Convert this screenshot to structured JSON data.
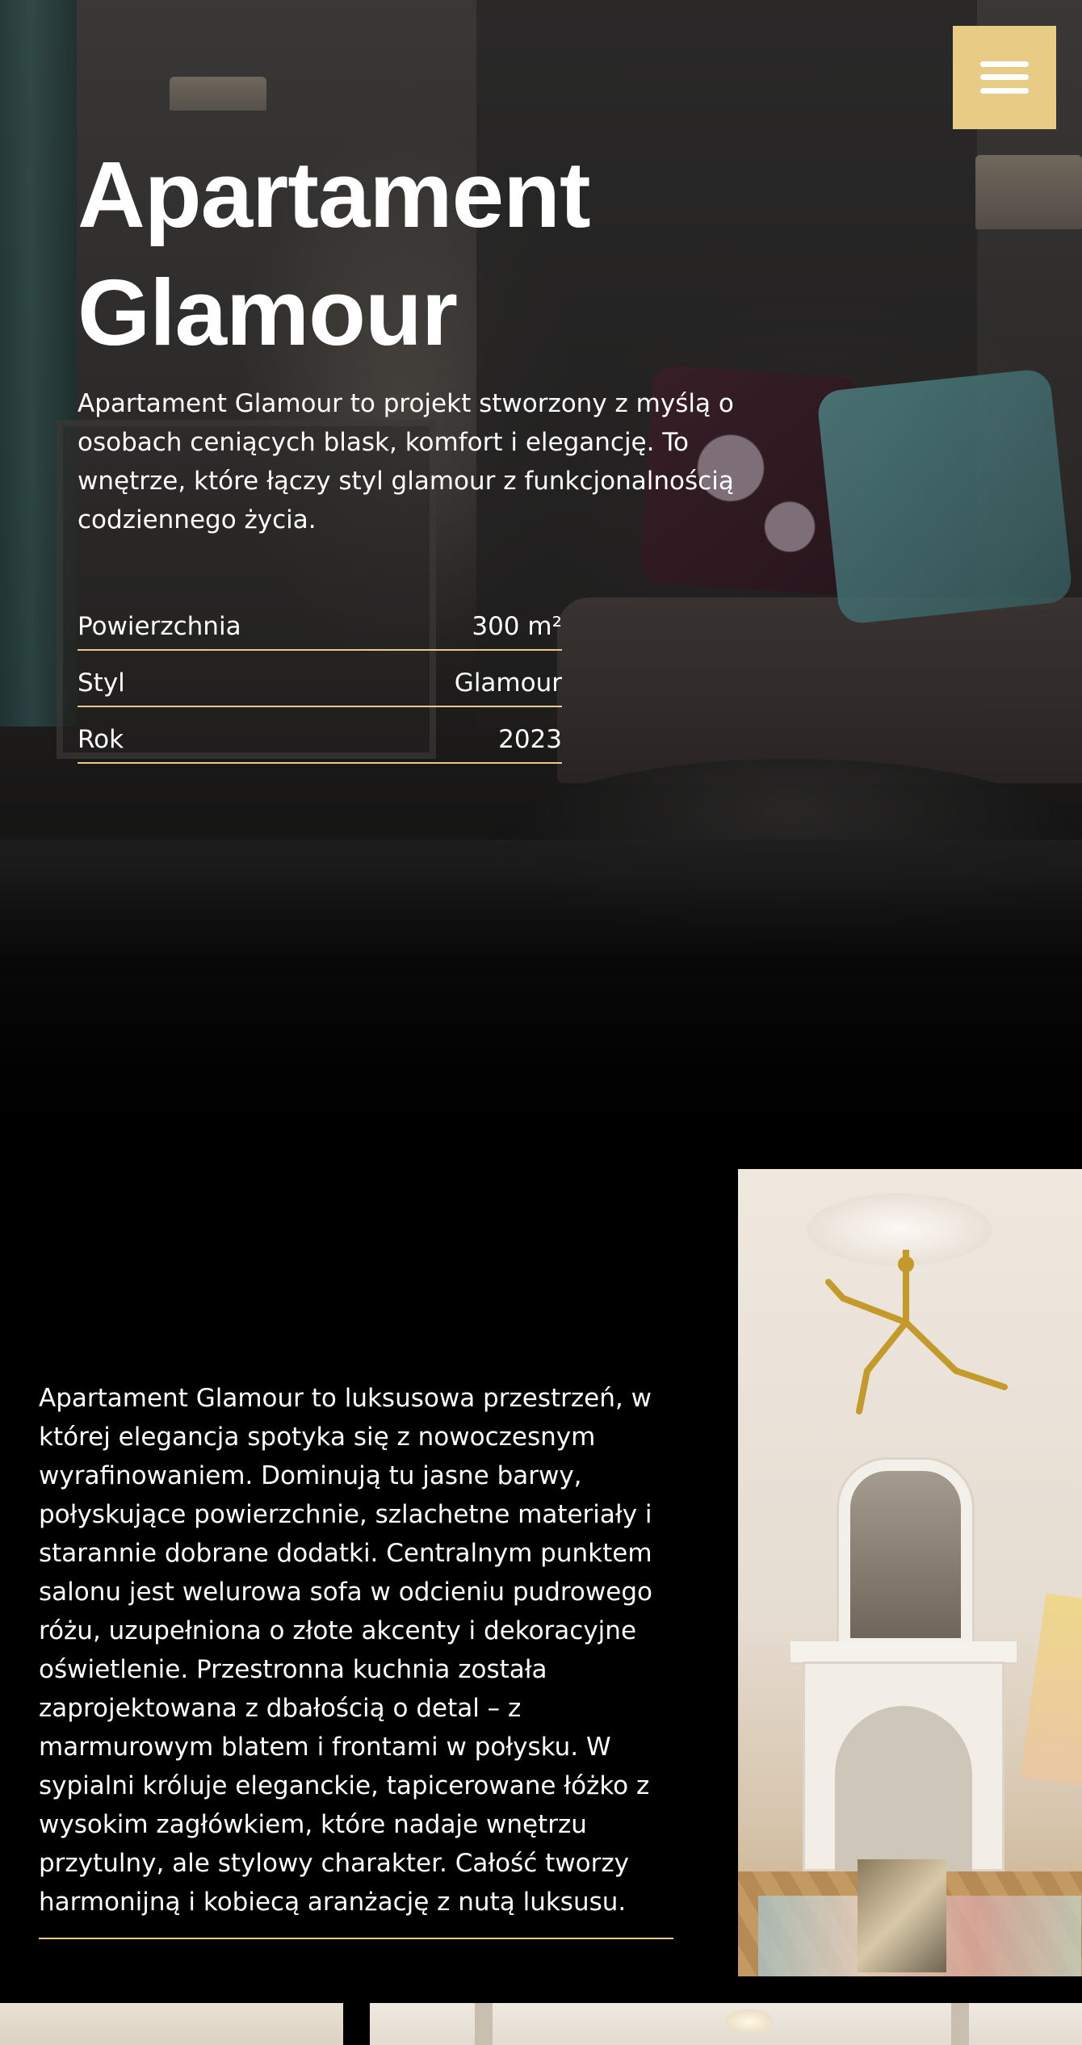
{
  "menu": {
    "icon": "hamburger-menu-icon",
    "color": "#e8cc86"
  },
  "hero": {
    "title": "Apartament Glamour",
    "description": "Apartament Glamour to projekt stworzony z myślą o osobach ceniących blask, komfort i elegancję. To wnętrze, które łączy styl glamour z funkcjonalnością codziennego życia.",
    "specs": [
      {
        "label": "Powierzchnia",
        "value": "300 m²"
      },
      {
        "label": "Styl",
        "value": "Glamour"
      },
      {
        "label": "Rok",
        "value": "2023"
      }
    ]
  },
  "about": {
    "text": "Apartament Glamour to luksusowa przestrzeń, w której elegancja spotyka się z nowoczesnym wyrafinowaniem. Dominują tu jasne barwy, połyskujące powierzchnie, szlachetne materiały i starannie dobrane dodatki. Centralnym punktem salonu jest welurowa sofa w odcieniu pudrowego różu, uzupełniona o złote akcenty i dekoracyjne oświetlenie. Przestronna kuchnia została zaprojektowana z dbałością o detal – z marmurowym blatem i frontami w połysku. W sypialni króluje eleganckie, tapicerowane łóżko z wysokim zagłówkiem, które nadaje wnętrzu przytulny, ale stylowy charakter. Całość tworzy harmonijną i kobiecą aranżację z nutą luksusu."
  },
  "colors": {
    "accent": "#e8cc86",
    "background": "#000000",
    "text": "#ffffff"
  }
}
